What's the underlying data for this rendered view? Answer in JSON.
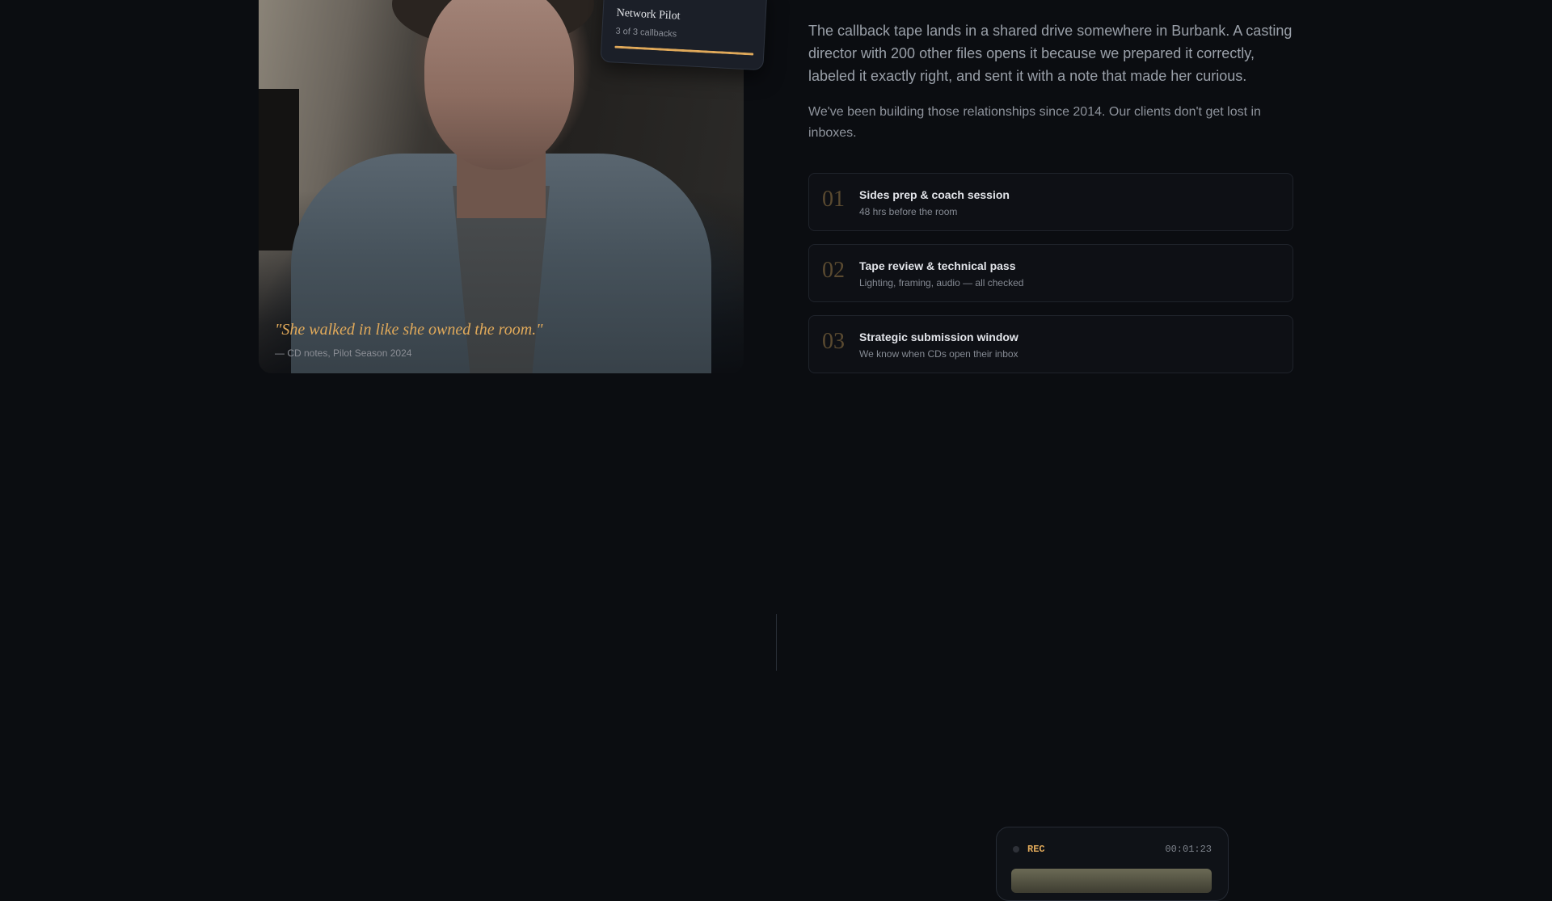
{
  "hero_photo": {
    "quote": "\"She walked in like she owned the room.\"",
    "quote_source": "— CD notes, Pilot Season 2024"
  },
  "progress_card": {
    "title": "Network Pilot",
    "subtitle": "3 of 3 callbacks",
    "progress_fraction": 1.0,
    "accent_color": "#e0a95a"
  },
  "copy": {
    "lead": "The callback tape lands in a shared drive somewhere in Burbank. A casting director with 200 other files opens it because we prepared it correctly, labeled it exactly right, and sent it with a note that made her curious.",
    "sub": "We've been building those relationships since 2014. Our clients don't get lost in inboxes."
  },
  "steps": [
    {
      "num": "01",
      "title": "Sides prep & coach session",
      "desc": "48 hrs before the room"
    },
    {
      "num": "02",
      "title": "Tape review & technical pass",
      "desc": "Lighting, framing, audio — all checked"
    },
    {
      "num": "03",
      "title": "Strategic submission window",
      "desc": "We know when CDs open their inbox"
    }
  ],
  "recorder": {
    "label": "REC",
    "timecode": "00:01:23"
  },
  "colors": {
    "background": "#0b0d11",
    "accent": "#e0a95a"
  }
}
